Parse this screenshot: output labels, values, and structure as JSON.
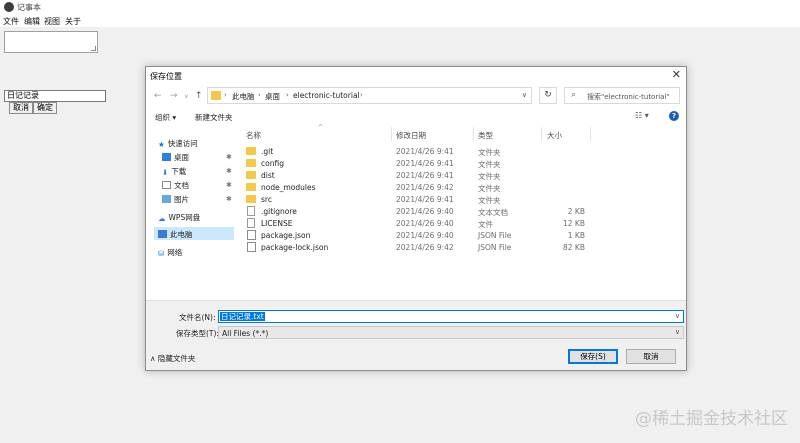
{
  "app": {
    "title": "记事本"
  },
  "menu": [
    "文件",
    "编辑",
    "视图",
    "关于"
  ],
  "editor": {
    "textarea_value": ""
  },
  "rename": {
    "input_value": "日记记录",
    "cancel_label": "取消",
    "confirm_label": "确定"
  },
  "dialog": {
    "title": "保存位置",
    "close_label": "✕",
    "address": {
      "crumbs": [
        "此电脑",
        "桌面",
        "electronic-tutorial"
      ]
    },
    "search_placeholder": "搜索\"electronic-tutorial\"",
    "toolbar": {
      "organize_label": "组织 ▾",
      "new_folder_label": "新建文件夹",
      "help_label": "?"
    },
    "sidebar": {
      "quick_access": "快速访问",
      "desktop": "桌面",
      "downloads": "下载",
      "documents": "文档",
      "pictures": "图片",
      "wps_cloud": "WPS网盘",
      "this_pc": "此电脑",
      "network": "网络"
    },
    "columns": {
      "name": "名称",
      "date": "修改日期",
      "type": "类型",
      "size": "大小"
    },
    "files": [
      {
        "name": ".git",
        "date": "2021/4/26 9:41",
        "type": "文件夹",
        "size": "",
        "icon": "folder"
      },
      {
        "name": "config",
        "date": "2021/4/26 9:41",
        "type": "文件夹",
        "size": "",
        "icon": "folder"
      },
      {
        "name": "dist",
        "date": "2021/4/26 9:41",
        "type": "文件夹",
        "size": "",
        "icon": "folder"
      },
      {
        "name": "node_modules",
        "date": "2021/4/26 9:42",
        "type": "文件夹",
        "size": "",
        "icon": "folder"
      },
      {
        "name": "src",
        "date": "2021/4/26 9:41",
        "type": "文件夹",
        "size": "",
        "icon": "folder"
      },
      {
        "name": ".gitignore",
        "date": "2021/4/26 9:40",
        "type": "文本文档",
        "size": "2 KB",
        "icon": "doc"
      },
      {
        "name": "LICENSE",
        "date": "2021/4/26 9:40",
        "type": "文件",
        "size": "12 KB",
        "icon": "doc"
      },
      {
        "name": "package.json",
        "date": "2021/4/26 9:40",
        "type": "JSON File",
        "size": "1 KB",
        "icon": "json"
      },
      {
        "name": "package-lock.json",
        "date": "2021/4/26 9:42",
        "type": "JSON File",
        "size": "82 KB",
        "icon": "json"
      }
    ],
    "filename_label": "文件名(N):",
    "filename_value": "日记记录.txt",
    "filetype_label": "保存类型(T):",
    "filetype_value": "All Files (*.*)",
    "hide_folders_label": "隐藏文件夹",
    "save_label": "保存(S)",
    "cancel_label": "取消"
  },
  "watermark": "@稀土掘金技术社区",
  "colors": {
    "accent": "#0078d7",
    "folder": "#f2c94c",
    "selected_nav": "#cce8ff"
  }
}
